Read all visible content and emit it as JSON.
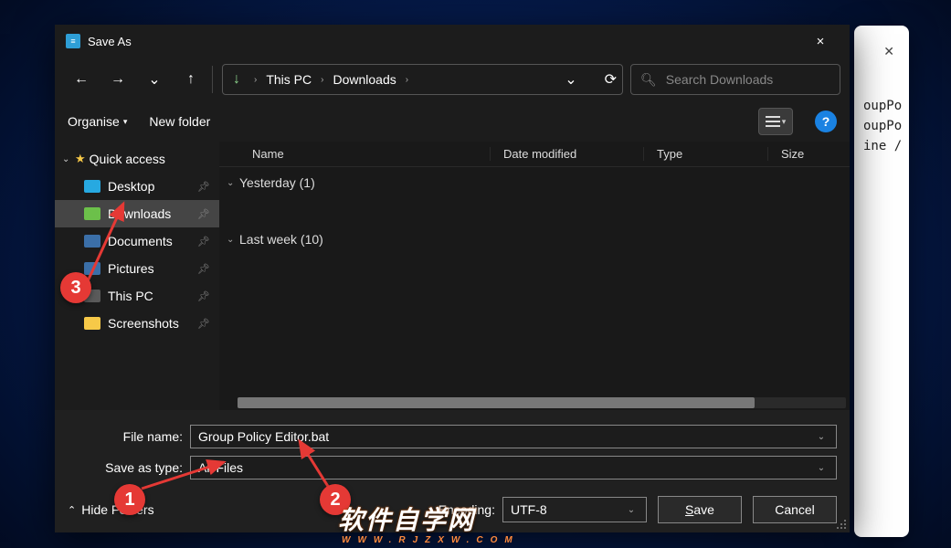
{
  "dialog": {
    "title": "Save As",
    "close_icon": "×"
  },
  "nav": {
    "back": "←",
    "forward": "→",
    "recent": "⌄",
    "up": "↑",
    "refresh": "⟳",
    "dropdown": "⌄"
  },
  "breadcrumb": {
    "root_icon": "↓",
    "items": [
      "This PC",
      "Downloads"
    ],
    "sep": "›"
  },
  "search": {
    "icon": "🔍",
    "placeholder": "Search Downloads"
  },
  "toolbar": {
    "organise": "Organise",
    "new_folder": "New folder",
    "help": "?"
  },
  "sidebar": {
    "quick_access": "Quick access",
    "items": [
      {
        "label": "Desktop",
        "color": "#27a9e1"
      },
      {
        "label": "Downloads",
        "color": "#6cc04a",
        "selected": true
      },
      {
        "label": "Documents",
        "color": "#3b6fa8"
      },
      {
        "label": "Pictures",
        "color": "#3b6fa8"
      },
      {
        "label": "This PC",
        "color": "#5a5a5a"
      },
      {
        "label": "Screenshots",
        "color": "#f7c948"
      }
    ]
  },
  "columns": {
    "name": "Name",
    "modified": "Date modified",
    "type": "Type",
    "size": "Size"
  },
  "groups": [
    {
      "label": "Yesterday (1)"
    },
    {
      "label": "Last week (10)"
    }
  ],
  "fields": {
    "file_name_label": "File name:",
    "file_name_value": "Group Policy Editor.bat",
    "save_type_label": "Save as type:",
    "save_type_value": "All Files",
    "encoding_label": "Encoding:",
    "encoding_value": "UTF-8"
  },
  "buttons": {
    "hide": "Hide Folders",
    "save": "Save",
    "cancel": "Cancel"
  },
  "behind_text": "oupPo\noupPo\nine /",
  "annotations": {
    "b1": "1",
    "b2": "2",
    "b3": "3"
  },
  "watermark": {
    "main": "软件自学网",
    "sub": "WWW.RJZXW.COM"
  }
}
